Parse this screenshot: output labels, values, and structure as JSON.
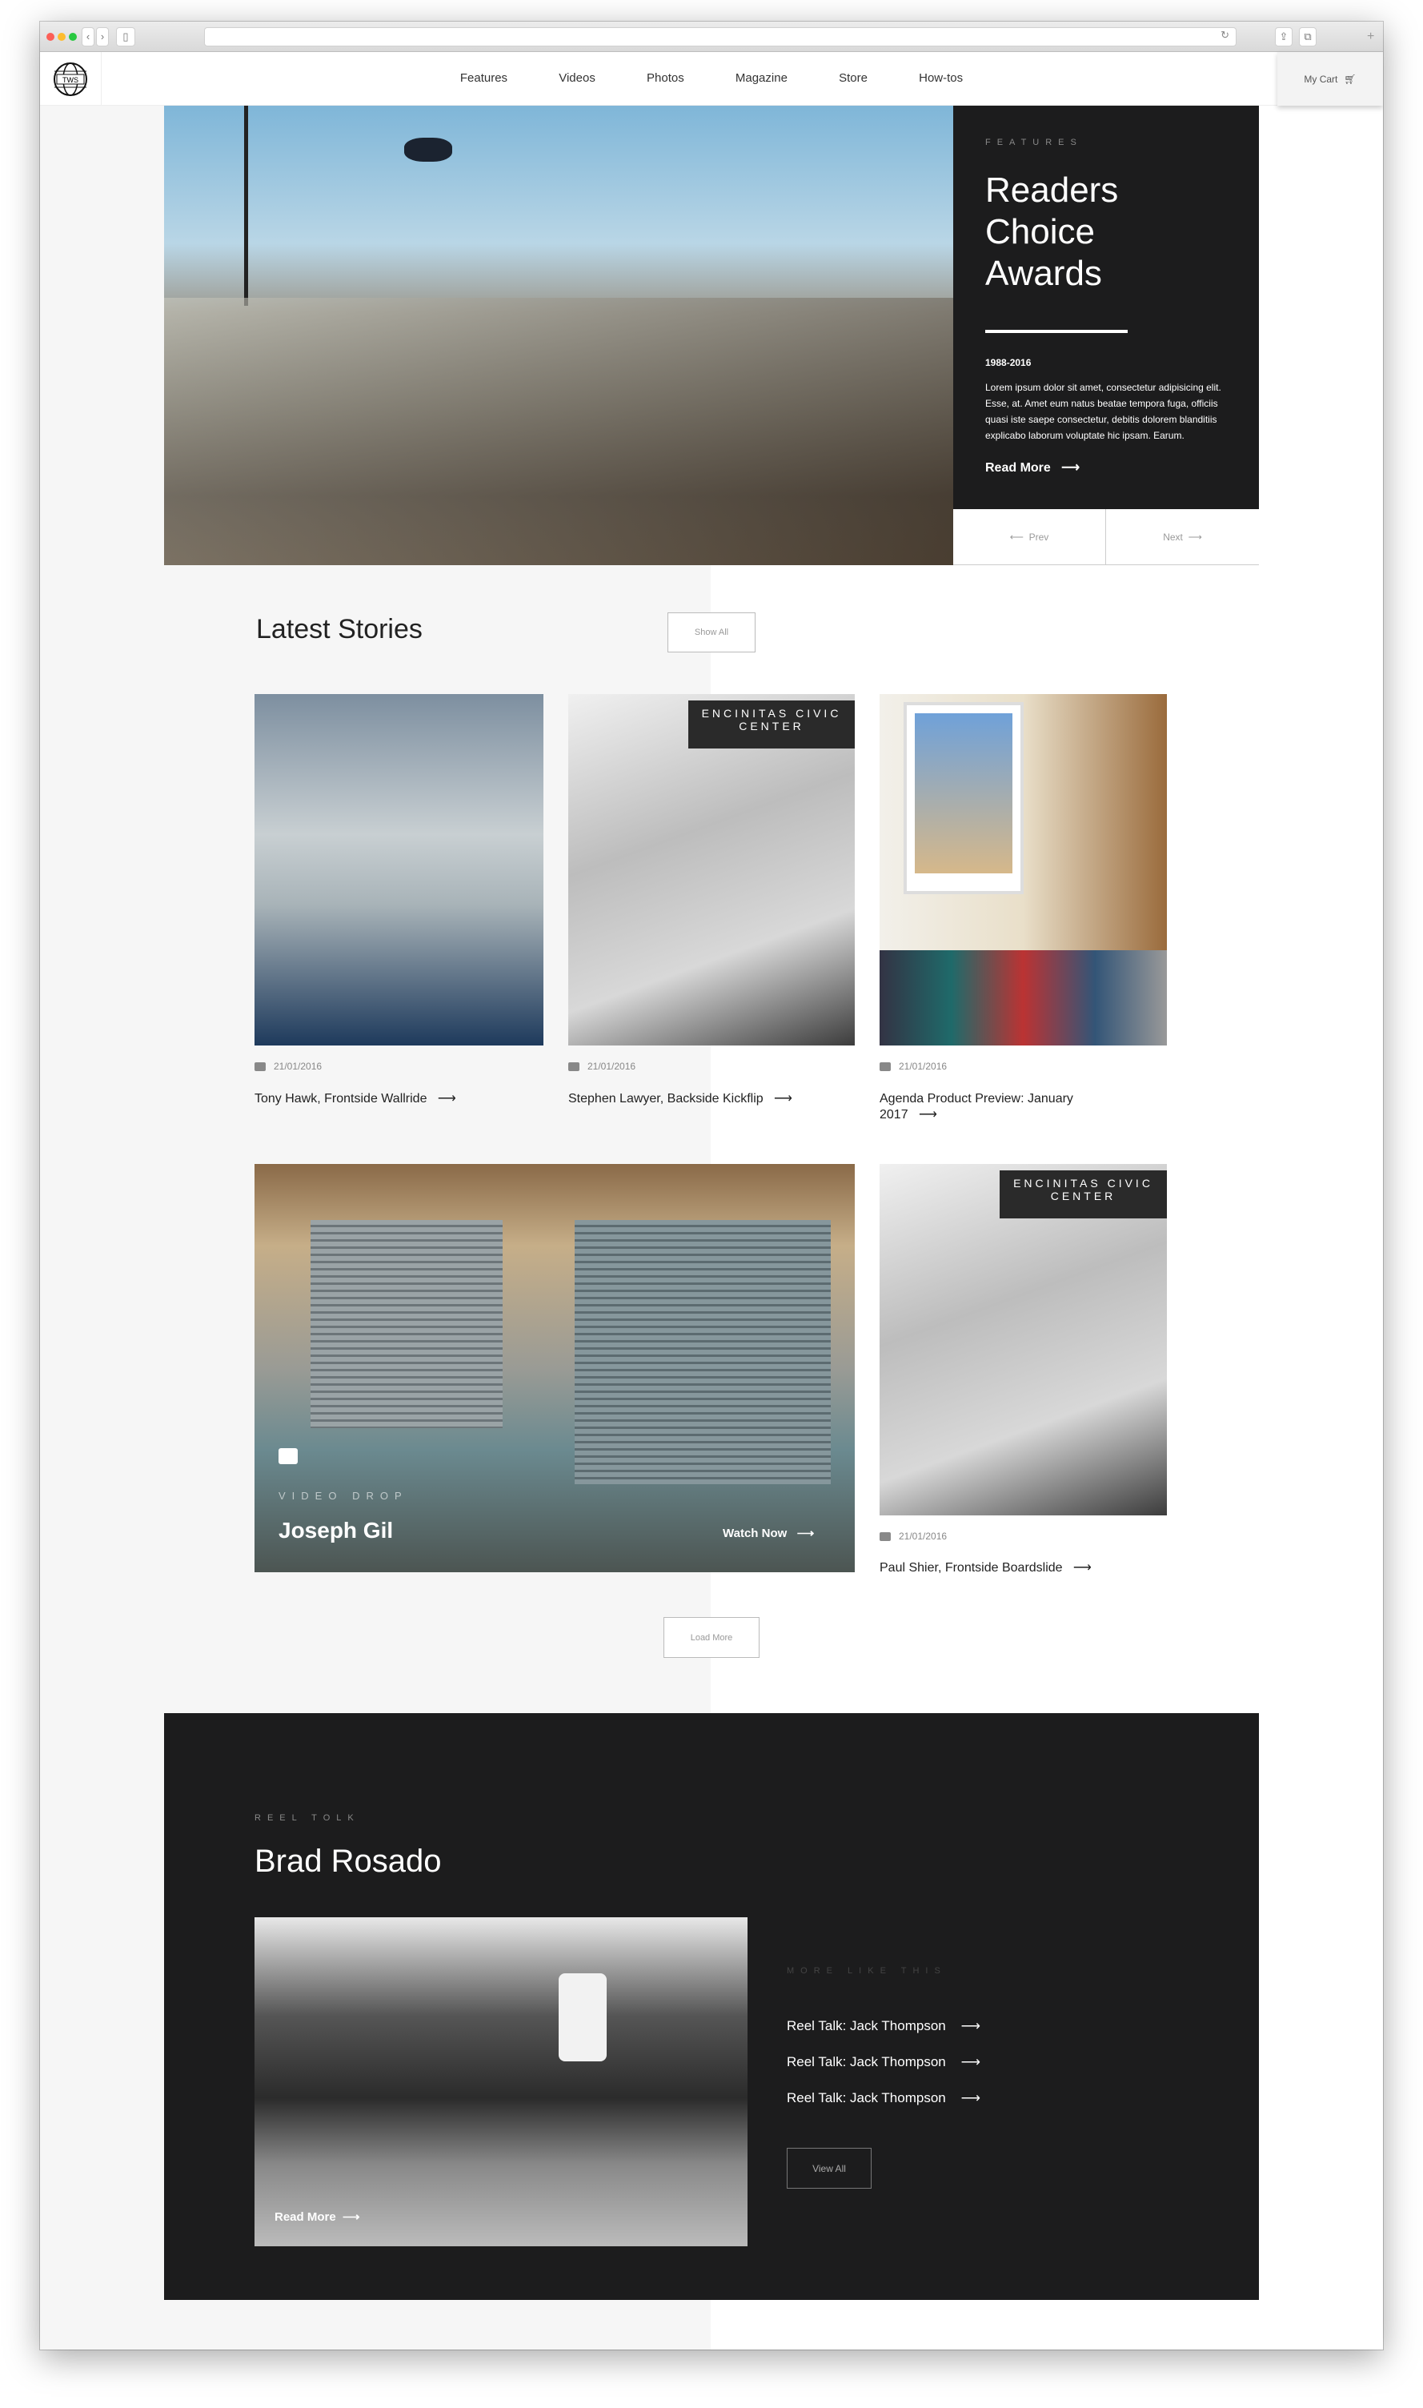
{
  "nav": {
    "items": [
      "Features",
      "Videos",
      "Photos",
      "Magazine",
      "Store",
      "How-tos"
    ],
    "cart": "My Cart",
    "logo_text": "TWS"
  },
  "hero": {
    "kicker": "FEATURES",
    "title": "Readers Choice Awards",
    "years": "1988-2016",
    "body": "Lorem ipsum dolor sit amet, consectetur adipisicing elit. Esse, at. Amet eum natus beatae tempora fuga, officiis quasi iste saepe consectetur, debitis dolorem blanditiis explicabo laborum voluptate hic ipsam. Earum.",
    "read_more": "Read More",
    "prev": "Prev",
    "next": "Next"
  },
  "latest": {
    "title": "Latest Stories",
    "show_all": "Show All",
    "load_more": "Load More",
    "cards": [
      {
        "date": "21/01/2016",
        "title": "Tony Hawk, Frontside Wallride"
      },
      {
        "date": "21/01/2016",
        "title": "Stephen Lawyer, Backside Kickflip"
      },
      {
        "date": "21/01/2016",
        "title": "Agenda Product Preview: January 2017"
      },
      {
        "date": "21/01/2016",
        "title": "Paul Shier, Frontside Boardslide"
      }
    ],
    "video": {
      "kicker": "VIDEO DROP",
      "title": "Joseph Gil",
      "cta": "Watch Now"
    },
    "sign": "ENCINITAS CIVIC CENTER"
  },
  "reel": {
    "kicker": "REEL TOLK",
    "title": "Brad Rosado",
    "read_more": "Read More",
    "more_kicker": "MORE LIKE THIS",
    "links": [
      "Reel Talk: Jack Thompson",
      "Reel Talk: Jack Thompson",
      "Reel Talk: Jack Thompson"
    ],
    "view_all": "View All"
  },
  "arrow": "⟶"
}
